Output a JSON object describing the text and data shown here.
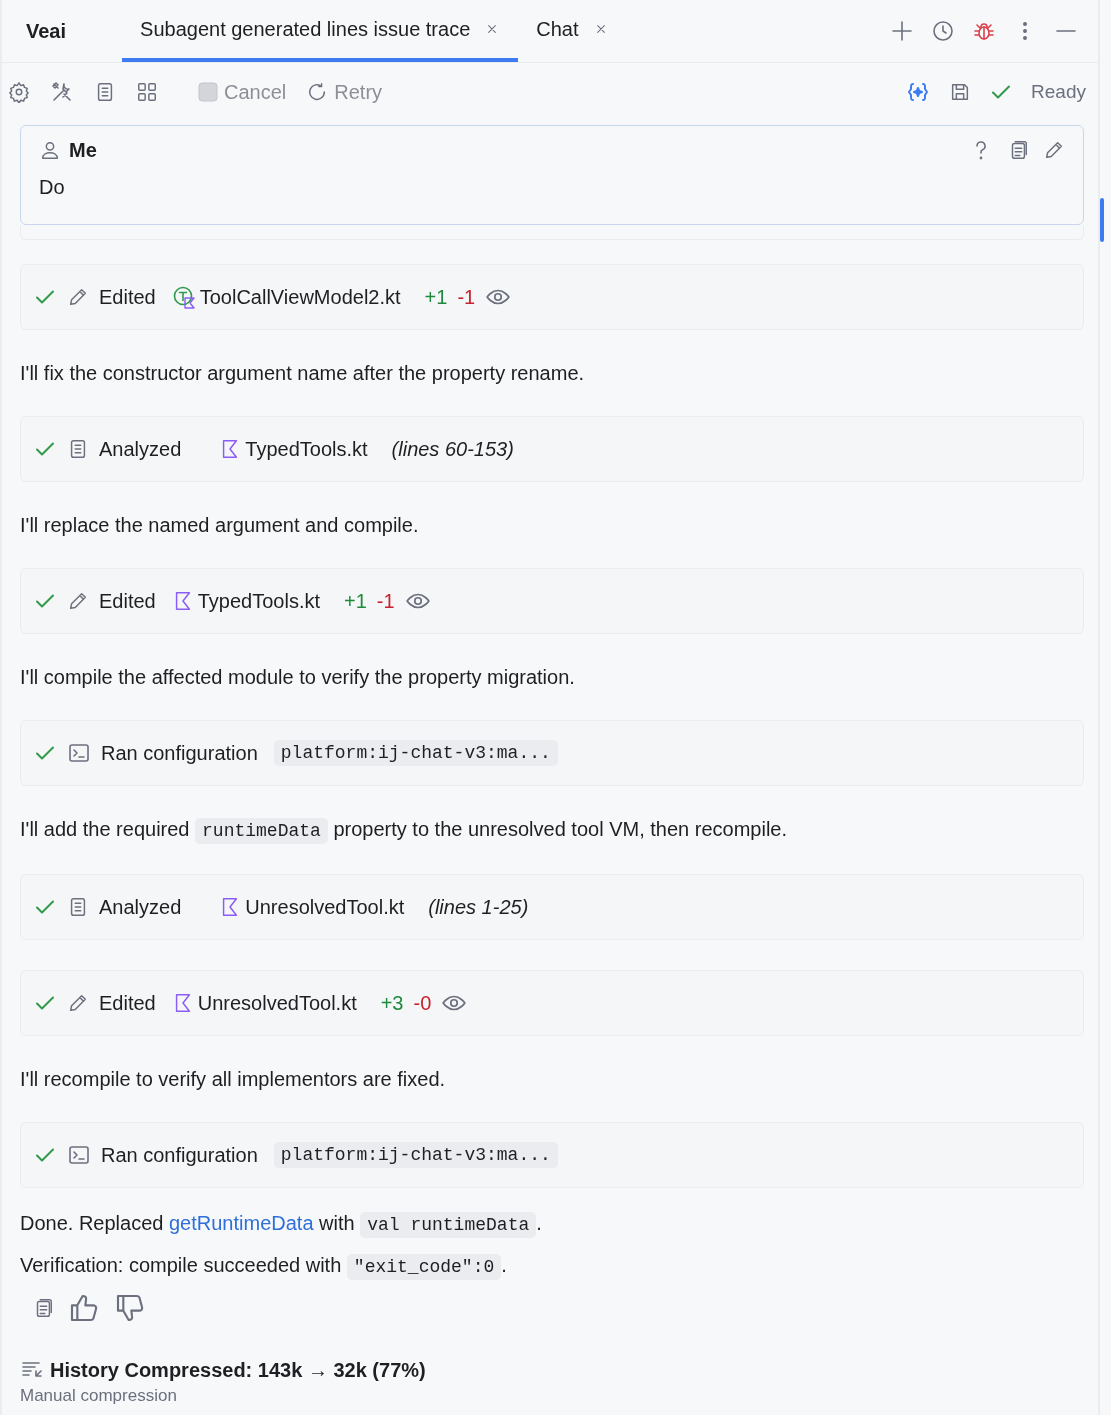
{
  "panel": {
    "title": "Veai",
    "tabs": [
      {
        "label": "Subagent generated lines issue trace",
        "selected": true
      },
      {
        "label": "Chat",
        "selected": false
      }
    ]
  },
  "toolbar": {
    "cancel": {
      "label": "Cancel",
      "disabled": true
    },
    "retry": {
      "label": "Retry",
      "disabled": true
    },
    "status": "Ready"
  },
  "user_message": {
    "author": "Me",
    "text": "Do"
  },
  "feed": [
    {
      "kind": "edit",
      "done": true,
      "label": "Edited",
      "file": {
        "kind": "test-class",
        "name": "ToolCallViewModel2.kt"
      },
      "added": "+1",
      "removed": "-1"
    },
    {
      "kind": "text",
      "parts": [
        {
          "kind": "text",
          "text": "I'll fix the constructor argument name after the property rename."
        }
      ]
    },
    {
      "kind": "analyze",
      "done": true,
      "label": "Analyzed",
      "file": {
        "kind": "kotlin",
        "name": "TypedTools.kt"
      },
      "range": "(lines 60-153)"
    },
    {
      "kind": "text",
      "parts": [
        {
          "kind": "text",
          "text": "I'll replace the named argument and compile."
        }
      ]
    },
    {
      "kind": "edit",
      "done": true,
      "label": "Edited",
      "file": {
        "kind": "kotlin",
        "name": "TypedTools.kt"
      },
      "added": "+1",
      "removed": "-1"
    },
    {
      "kind": "text",
      "parts": [
        {
          "kind": "text",
          "text": "I'll compile the affected module to verify the property migration."
        }
      ]
    },
    {
      "kind": "run",
      "done": true,
      "label": "Ran configuration",
      "target": "platform:ij-chat-v3:ma..."
    },
    {
      "kind": "text",
      "parts": [
        {
          "kind": "text",
          "text": "I'll add the required "
        },
        {
          "kind": "code",
          "text": "runtimeData"
        },
        {
          "kind": "text",
          "text": " property to the unresolved tool VM, then recompile."
        }
      ]
    },
    {
      "kind": "analyze",
      "done": true,
      "label": "Analyzed",
      "file": {
        "kind": "kotlin",
        "name": "UnresolvedTool.kt"
      },
      "range": "(lines 1-25)"
    },
    {
      "kind": "edit",
      "done": true,
      "label": "Edited",
      "file": {
        "kind": "kotlin",
        "name": "UnresolvedTool.kt"
      },
      "added": "+3",
      "removed": "-0"
    },
    {
      "kind": "text",
      "parts": [
        {
          "kind": "text",
          "text": "I'll recompile to verify all implementors are fixed."
        }
      ]
    },
    {
      "kind": "run",
      "done": true,
      "label": "Ran configuration",
      "target": "platform:ij-chat-v3:ma..."
    },
    {
      "kind": "text",
      "parts": [
        {
          "kind": "text",
          "text": "Done. Replaced "
        },
        {
          "kind": "link",
          "text": "getRuntimeData"
        },
        {
          "kind": "text",
          "text": " with "
        },
        {
          "kind": "code",
          "text": "val runtimeData"
        },
        {
          "kind": "text",
          "text": "."
        }
      ]
    },
    {
      "kind": "text",
      "parts": [
        {
          "kind": "text",
          "text": "Verification: compile succeeded with "
        },
        {
          "kind": "code",
          "text": "\"exit_code\":0"
        },
        {
          "kind": "text",
          "text": "."
        }
      ]
    }
  ],
  "history": {
    "title": "History Compressed: 143k → 32k (77%)",
    "subtitle": "Manual compression"
  }
}
